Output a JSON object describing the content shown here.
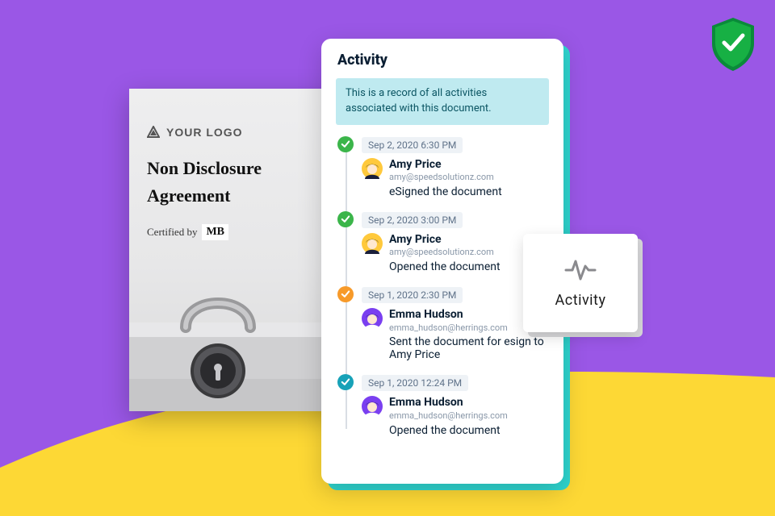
{
  "document": {
    "logo_text": "YOUR LOGO",
    "title_line1": "Non Disclosure",
    "title_line2": "Agreement",
    "certified_prefix": "Certified by",
    "certified_brand": "MB"
  },
  "panel": {
    "title": "Activity",
    "notice": "This is a record of all activities associated with this document."
  },
  "chip": {
    "label": "Activity"
  },
  "status_colors": {
    "green": "#3bb54a",
    "orange": "#f79a2a",
    "teal": "#17a2b8"
  },
  "avatar_colors": {
    "amy": "#ffc93c",
    "emma": "#7a3ff0"
  },
  "activity": [
    {
      "status": "green",
      "timestamp": "Sep 2, 2020 6:30 PM",
      "user": {
        "name": "Amy Price",
        "email": "amy@speedsolutionz.com",
        "avatar": "amy"
      },
      "action": "eSigned the document"
    },
    {
      "status": "green",
      "timestamp": "Sep 2, 2020 3:00 PM",
      "user": {
        "name": "Amy Price",
        "email": "amy@speedsolutionz.com",
        "avatar": "amy"
      },
      "action": "Opened the document"
    },
    {
      "status": "orange",
      "timestamp": "Sep 1, 2020 2:30 PM",
      "user": {
        "name": "Emma Hudson",
        "email": "emma_hudson@herrings.com",
        "avatar": "emma"
      },
      "action": "Sent the document for esign to Amy Price"
    },
    {
      "status": "teal",
      "timestamp": "Sep 1, 2020 12:24 PM",
      "user": {
        "name": "Emma Hudson",
        "email": "emma_hudson@herrings.com",
        "avatar": "emma"
      },
      "action": "Opened the document"
    }
  ]
}
